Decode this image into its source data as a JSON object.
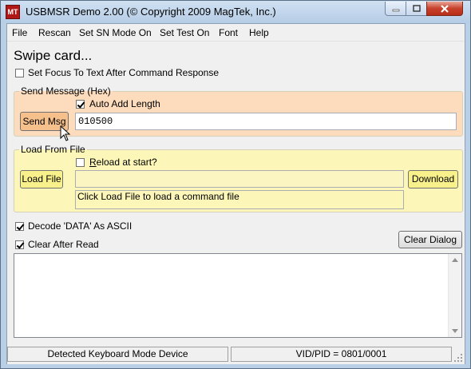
{
  "window": {
    "title": "USBMSR Demo 2.00 (© Copyright 2009 MagTek, Inc.)",
    "icon_label": "MT"
  },
  "menu": [
    "File",
    "Rescan",
    "Set SN Mode On",
    "Set Test On",
    "Font",
    "Help"
  ],
  "swipe_label": "Swipe card...",
  "set_focus": {
    "label": "Set Focus To Text After Command Response",
    "checked": false
  },
  "send_message": {
    "title": "Send Message (Hex)",
    "auto_add_length": {
      "label": "Auto Add Length",
      "checked": true
    },
    "button": "Send Msg",
    "value": "010500"
  },
  "load_from_file": {
    "title": "Load From File",
    "reload_at_start": {
      "label": "Reload at start?",
      "checked": false
    },
    "load_button": "Load File",
    "path_value": "",
    "download_button": "Download",
    "hint": "Click Load File to load a command file"
  },
  "decode_ascii": {
    "label": "Decode 'DATA' As ASCII",
    "checked": true
  },
  "clear_after_read": {
    "label": "Clear After Read",
    "checked": true
  },
  "clear_dialog_button": "Clear Dialog",
  "output_text": "",
  "status": {
    "left": "Detected Keyboard Mode Device",
    "right": "VID/PID = 0801/0001"
  },
  "colors": {
    "send_group_bg": "#fcdcbc",
    "load_group_bg": "#fcf6b8",
    "send_btn_bg": "#f6c08c",
    "load_btn_bg": "#f8f08a",
    "titlebar": "#b9cfe6",
    "close_button": "#c7412c"
  }
}
